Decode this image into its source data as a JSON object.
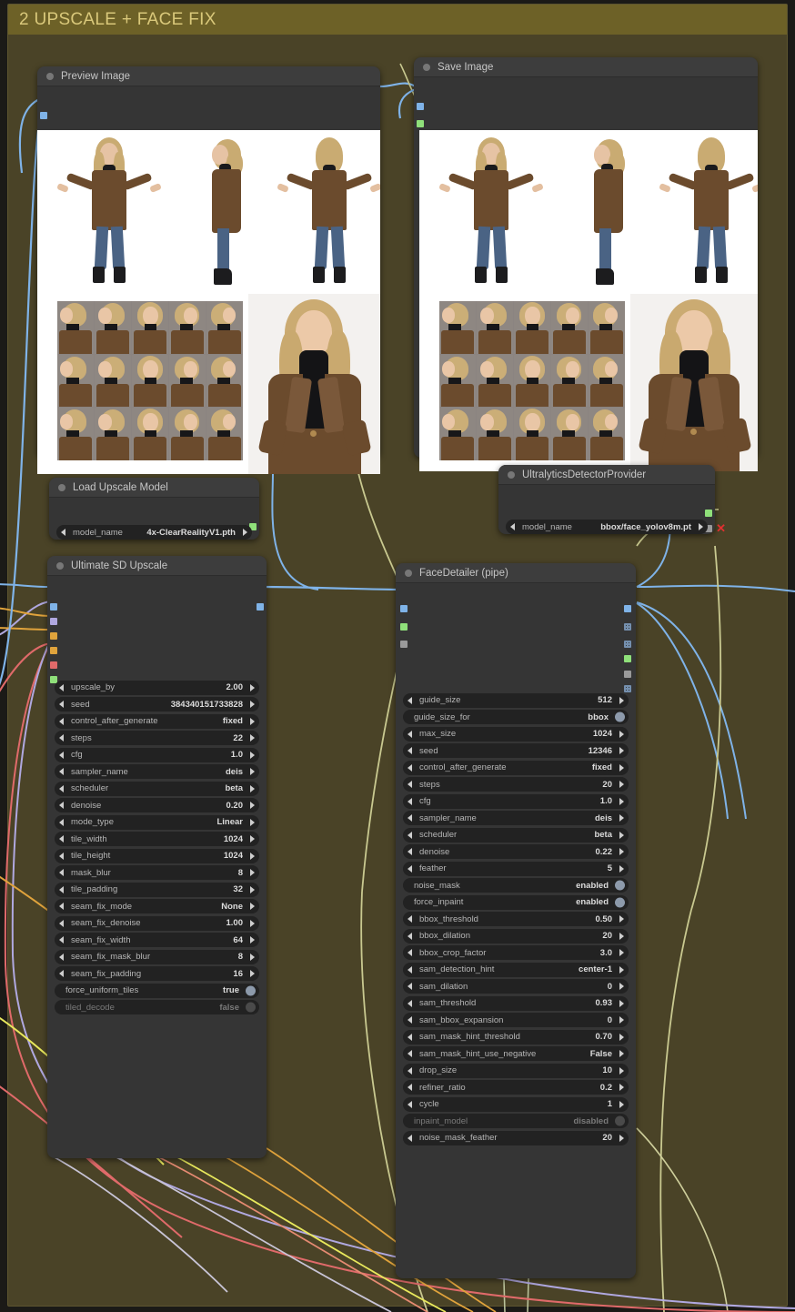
{
  "group": {
    "title": "2 UPSCALE + FACE FIX",
    "header_color": "#6d6127",
    "body_color": "#4a4327"
  },
  "canvas": {
    "background": "#1b1a17"
  },
  "nodes": {
    "preview_image": {
      "title": "Preview Image",
      "ports": {
        "input_image": "#7fb3e8"
      }
    },
    "save_image": {
      "title": "Save Image",
      "ports": {
        "input_image": "#7fb3e8",
        "input_extra": "#8fe07a"
      }
    },
    "load_upscale_model": {
      "title": "Load Upscale Model",
      "widgets": [
        {
          "name": "model_name",
          "value": "4x-ClearRealityV1.pth",
          "type": "combo"
        }
      ],
      "ports": {
        "output_upscale_model": "#8fe07a"
      }
    },
    "ultralytics_detector_provider": {
      "title": "UltralyticsDetectorProvider",
      "widgets": [
        {
          "name": "model_name",
          "value": "bbox/face_yolov8m.pt",
          "type": "combo"
        }
      ],
      "ports": {
        "output_bbox_detector": "#8fe07a",
        "output_segm_detector": "#9a9a9a"
      },
      "error_marker": "x"
    },
    "ultimate_sd_upscale": {
      "title": "Ultimate SD Upscale",
      "input_ports": [
        "#7fb3e8",
        "#b0a8e0",
        "#e0a33c",
        "#e0a33c",
        "#e06a6a",
        "#8fe07a"
      ],
      "output_ports": [
        "#7fb3e8"
      ],
      "widgets": [
        {
          "name": "upscale_by",
          "value": "2.00",
          "type": "number"
        },
        {
          "name": "seed",
          "value": "384340151733828",
          "type": "number"
        },
        {
          "name": "control_after_generate",
          "value": "fixed",
          "type": "combo"
        },
        {
          "name": "steps",
          "value": "22",
          "type": "number"
        },
        {
          "name": "cfg",
          "value": "1.0",
          "type": "number"
        },
        {
          "name": "sampler_name",
          "value": "deis",
          "type": "combo"
        },
        {
          "name": "scheduler",
          "value": "beta",
          "type": "combo"
        },
        {
          "name": "denoise",
          "value": "0.20",
          "type": "number"
        },
        {
          "name": "mode_type",
          "value": "Linear",
          "type": "combo"
        },
        {
          "name": "tile_width",
          "value": "1024",
          "type": "number"
        },
        {
          "name": "tile_height",
          "value": "1024",
          "type": "number"
        },
        {
          "name": "mask_blur",
          "value": "8",
          "type": "number"
        },
        {
          "name": "tile_padding",
          "value": "32",
          "type": "number"
        },
        {
          "name": "seam_fix_mode",
          "value": "None",
          "type": "combo"
        },
        {
          "name": "seam_fix_denoise",
          "value": "1.00",
          "type": "number"
        },
        {
          "name": "seam_fix_width",
          "value": "64",
          "type": "number"
        },
        {
          "name": "seam_fix_mask_blur",
          "value": "8",
          "type": "number"
        },
        {
          "name": "seam_fix_padding",
          "value": "16",
          "type": "number"
        },
        {
          "name": "force_uniform_tiles",
          "value": "true",
          "type": "toggle",
          "on": true
        },
        {
          "name": "tiled_decode",
          "value": "false",
          "type": "toggle",
          "on": false
        }
      ]
    },
    "face_detailer": {
      "title": "FaceDetailer (pipe)",
      "input_ports": [
        "#7fb3e8",
        "#8fe07a",
        "#9a9a9a"
      ],
      "output_ports": [
        "#7fb3e8",
        "grid",
        "grid",
        "#8fe07a",
        "#9a9a9a",
        "grid"
      ],
      "widgets": [
        {
          "name": "guide_size",
          "value": "512",
          "type": "number"
        },
        {
          "name": "guide_size_for",
          "value": "bbox",
          "type": "toggle",
          "on": true
        },
        {
          "name": "max_size",
          "value": "1024",
          "type": "number"
        },
        {
          "name": "seed",
          "value": "12346",
          "type": "number"
        },
        {
          "name": "control_after_generate",
          "value": "fixed",
          "type": "combo"
        },
        {
          "name": "steps",
          "value": "20",
          "type": "number"
        },
        {
          "name": "cfg",
          "value": "1.0",
          "type": "number"
        },
        {
          "name": "sampler_name",
          "value": "deis",
          "type": "combo"
        },
        {
          "name": "scheduler",
          "value": "beta",
          "type": "combo"
        },
        {
          "name": "denoise",
          "value": "0.22",
          "type": "number"
        },
        {
          "name": "feather",
          "value": "5",
          "type": "number"
        },
        {
          "name": "noise_mask",
          "value": "enabled",
          "type": "toggle",
          "on": true
        },
        {
          "name": "force_inpaint",
          "value": "enabled",
          "type": "toggle",
          "on": true
        },
        {
          "name": "bbox_threshold",
          "value": "0.50",
          "type": "number"
        },
        {
          "name": "bbox_dilation",
          "value": "20",
          "type": "number"
        },
        {
          "name": "bbox_crop_factor",
          "value": "3.0",
          "type": "number"
        },
        {
          "name": "sam_detection_hint",
          "value": "center-1",
          "type": "combo"
        },
        {
          "name": "sam_dilation",
          "value": "0",
          "type": "number"
        },
        {
          "name": "sam_threshold",
          "value": "0.93",
          "type": "number"
        },
        {
          "name": "sam_bbox_expansion",
          "value": "0",
          "type": "number"
        },
        {
          "name": "sam_mask_hint_threshold",
          "value": "0.70",
          "type": "number"
        },
        {
          "name": "sam_mask_hint_use_negative",
          "value": "False",
          "type": "combo"
        },
        {
          "name": "drop_size",
          "value": "10",
          "type": "number"
        },
        {
          "name": "refiner_ratio",
          "value": "0.2",
          "type": "number"
        },
        {
          "name": "cycle",
          "value": "1",
          "type": "number"
        },
        {
          "name": "inpaint_model",
          "value": "disabled",
          "type": "toggle",
          "on": false
        },
        {
          "name": "noise_mask_feather",
          "value": "20",
          "type": "number"
        }
      ]
    }
  },
  "wire_colors": {
    "image": "#7fb3e8",
    "model": "#b0a8e0",
    "conditioning": "#e0a33c",
    "latent": "#e06a6a",
    "vae": "#e8e85c",
    "upscale_model": "#c9c990",
    "detector": "#c3c38a"
  }
}
